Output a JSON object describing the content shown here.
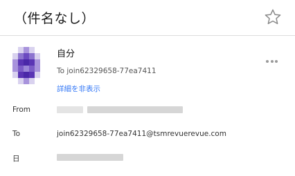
{
  "header": {
    "subject": "（件名なし）",
    "star_icon": "star-outline-icon"
  },
  "sender": {
    "name": "自分",
    "to_line": "To join62329658-77ea7411",
    "toggle_details": "詳細を非表示",
    "avatar_colors": [
      "#7b5cc7",
      "#5a35b4",
      "#a893dc",
      "#d9d2ef"
    ],
    "more_icon": "more-horizontal-icon"
  },
  "details": {
    "from_label": "From",
    "to_label": "To",
    "to_value": "join62329658-77ea7411@tsmrevuerevue.com",
    "date_label": "日"
  },
  "colors": {
    "link": "#3478f6",
    "divider": "#dddddd"
  }
}
